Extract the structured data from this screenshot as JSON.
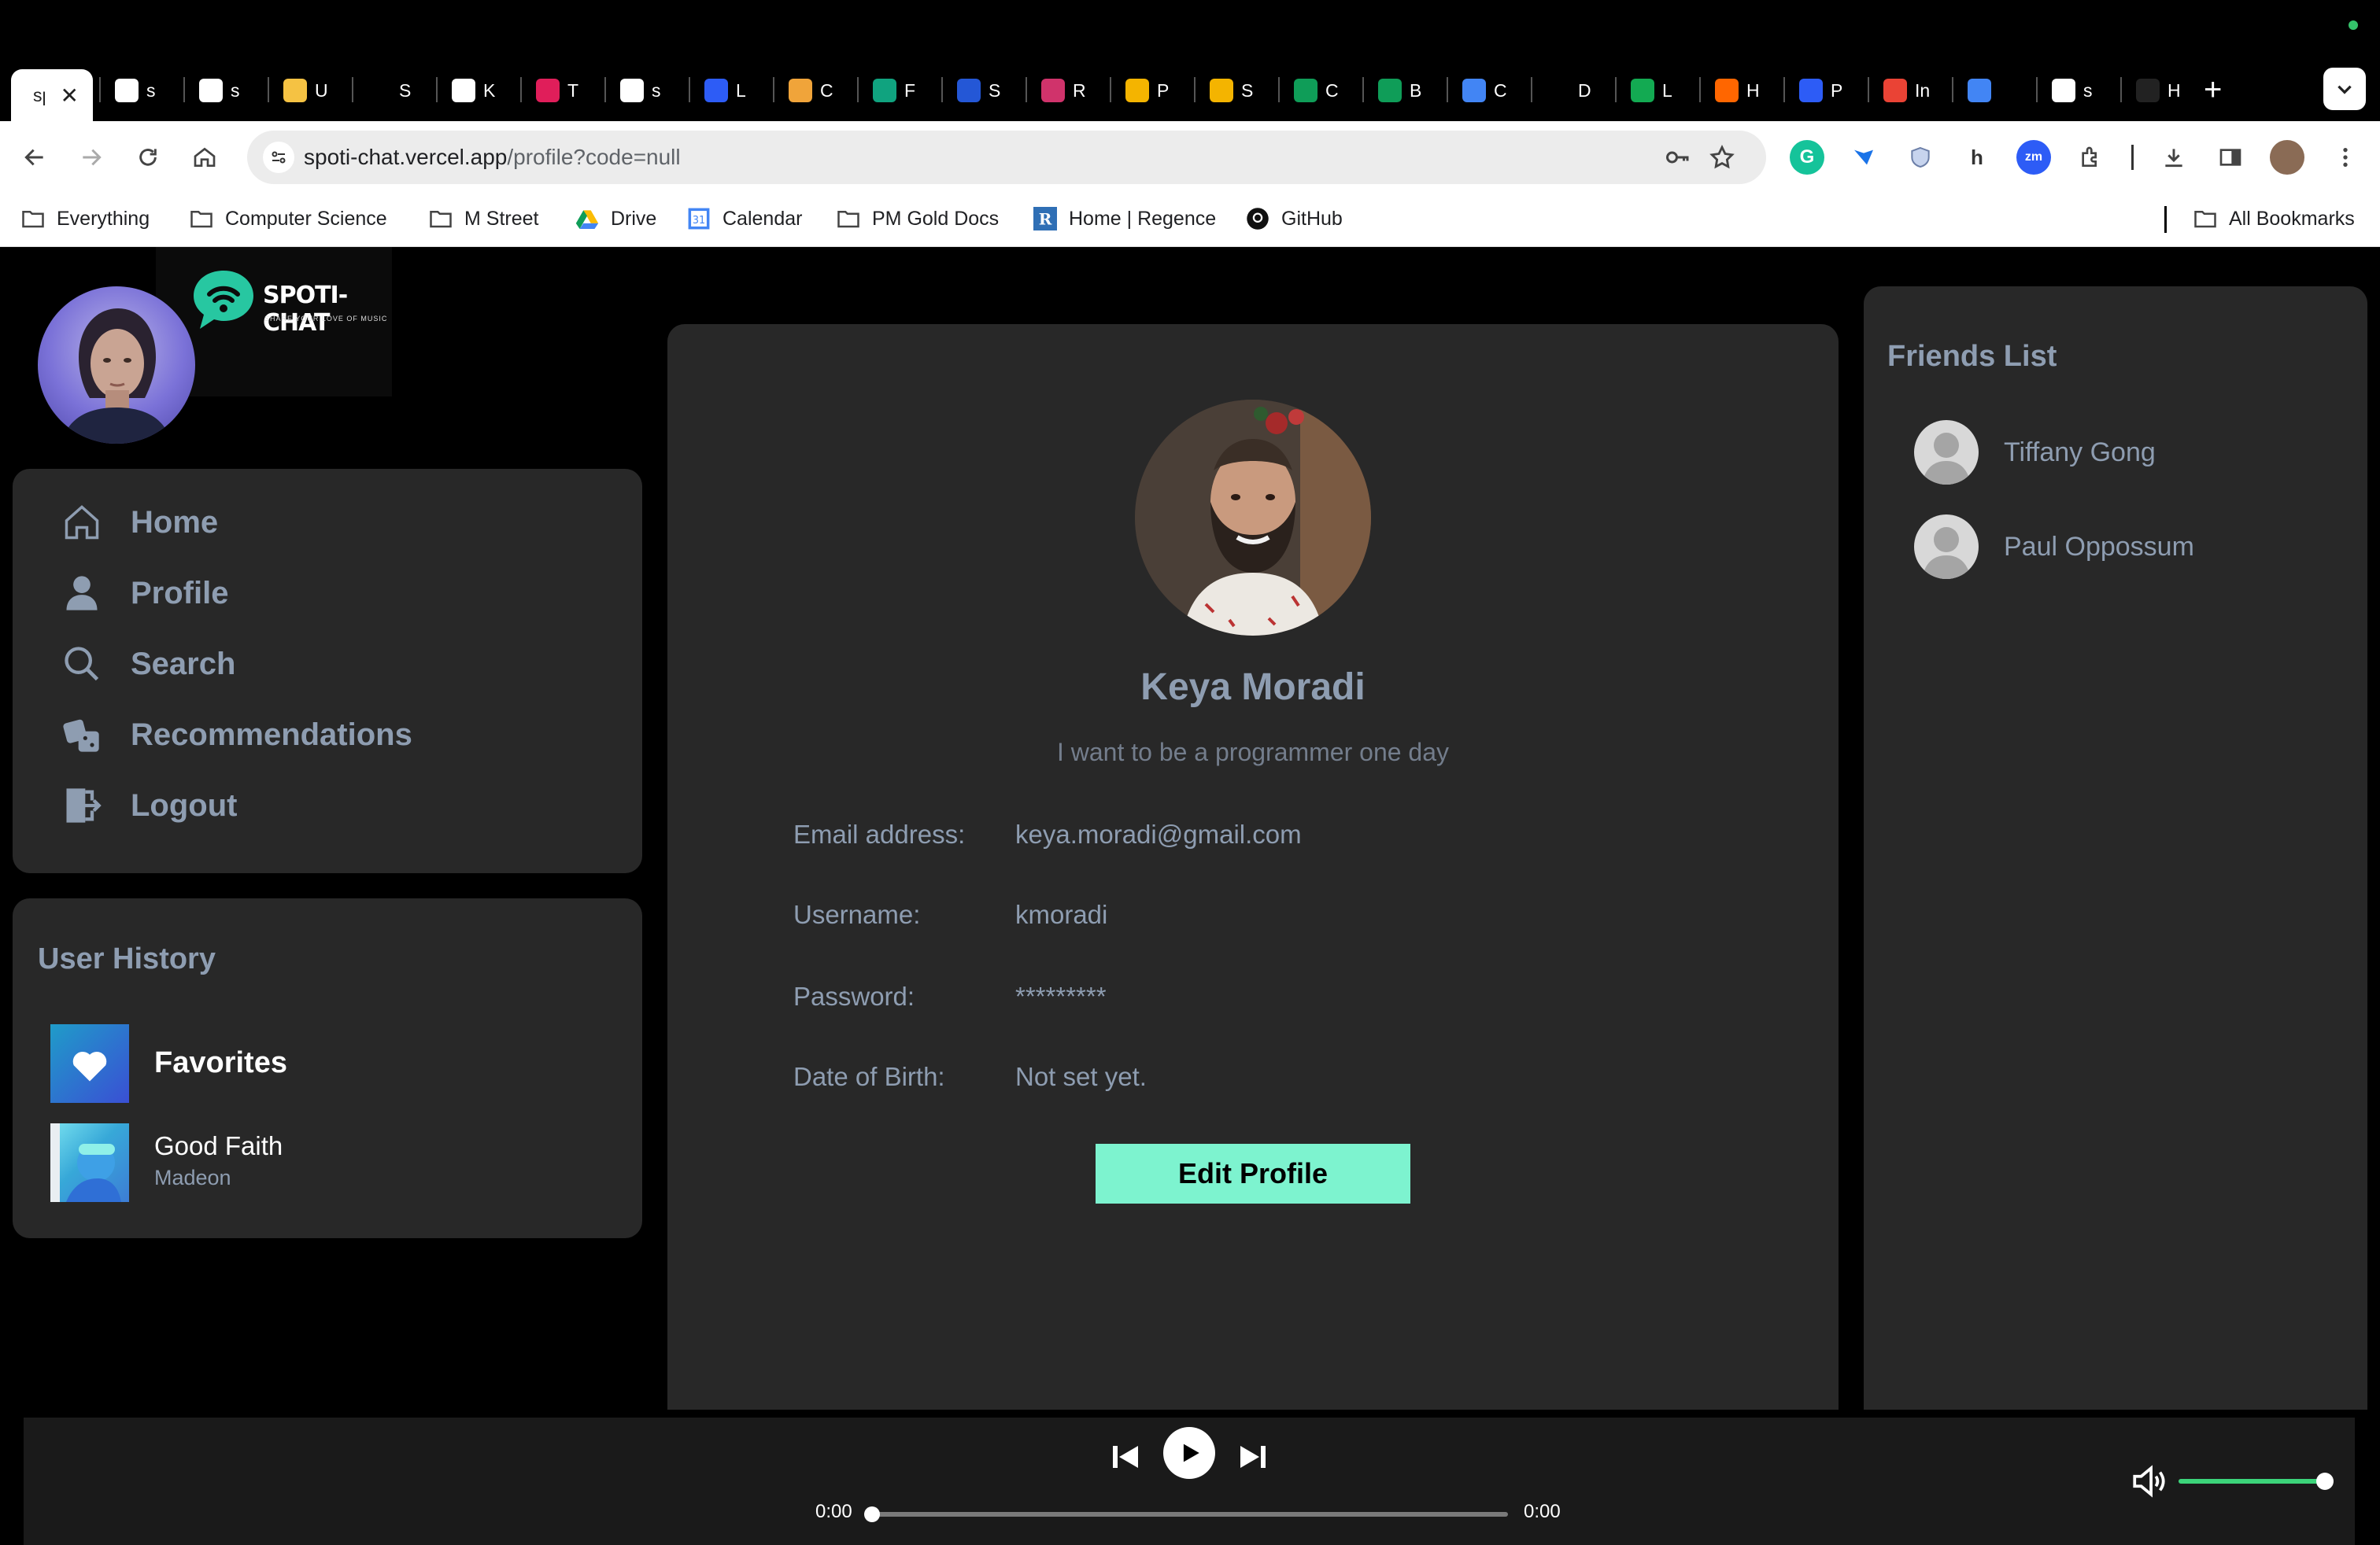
{
  "browser": {
    "tabs": [
      {
        "label": "sp",
        "fav_color": "#ffffff",
        "active": true
      },
      {
        "label": "s",
        "fav_color": "#ffffff"
      },
      {
        "label": "s",
        "fav_color": "#ffffff"
      },
      {
        "label": "U",
        "fav_color": "#f5c243"
      },
      {
        "label": "S",
        "fav_color": "#000000"
      },
      {
        "label": "K",
        "fav_color": "#ffffff"
      },
      {
        "label": "T",
        "fav_color": "#e01e5a"
      },
      {
        "label": "s",
        "fav_color": "#ffffff"
      },
      {
        "label": "L",
        "fav_color": "#2d5cf6"
      },
      {
        "label": "C",
        "fav_color": "#f0a43a"
      },
      {
        "label": "F",
        "fav_color": "#10a37f"
      },
      {
        "label": "S",
        "fav_color": "#2457d6"
      },
      {
        "label": "R",
        "fav_color": "#d0336b"
      },
      {
        "label": "P",
        "fav_color": "#f4b400"
      },
      {
        "label": "S",
        "fav_color": "#f4b400"
      },
      {
        "label": "C",
        "fav_color": "#0f9d58"
      },
      {
        "label": "B",
        "fav_color": "#0f9d58"
      },
      {
        "label": "C",
        "fav_color": "#4285f4"
      },
      {
        "label": "D",
        "fav_color": "#000000"
      },
      {
        "label": "L",
        "fav_color": "#13aa52"
      },
      {
        "label": "H",
        "fav_color": "#ff6600"
      },
      {
        "label": "P",
        "fav_color": "#2d5cf6"
      },
      {
        "label": "In",
        "fav_color": "#ea4335"
      },
      {
        "label": "",
        "fav_color": "#4285f4"
      },
      {
        "label": "s",
        "fav_color": "#ffffff"
      },
      {
        "label": "H",
        "fav_color": "#222222"
      }
    ],
    "url_host": "spoti-chat.vercel.app",
    "url_path": "/profile?code=null",
    "bookmarks": [
      {
        "label": "Everything",
        "icon": "folder-icon"
      },
      {
        "label": "Computer Science",
        "icon": "folder-icon"
      },
      {
        "label": "M Street",
        "icon": "folder-icon"
      },
      {
        "label": "Drive",
        "icon": "drive-icon"
      },
      {
        "label": "Calendar",
        "icon": "calendar-icon"
      },
      {
        "label": "PM Gold Docs",
        "icon": "folder-icon"
      },
      {
        "label": "Home | Regence",
        "icon": "regence-icon"
      },
      {
        "label": "GitHub",
        "icon": "github-icon"
      }
    ],
    "all_bookmarks": "All Bookmarks"
  },
  "app": {
    "logo": {
      "name": "SPOTI-CHAT",
      "tagline": "SHARE YOUR LOVE OF MUSIC"
    },
    "nav": [
      {
        "label": "Home",
        "icon": "home-icon"
      },
      {
        "label": "Profile",
        "icon": "person-icon"
      },
      {
        "label": "Search",
        "icon": "search-icon"
      },
      {
        "label": "Recommendations",
        "icon": "dice-icon"
      },
      {
        "label": "Logout",
        "icon": "logout-icon"
      }
    ],
    "history": {
      "title": "User History",
      "favorites_label": "Favorites",
      "track": {
        "title": "Good Faith",
        "artist": "Madeon"
      }
    },
    "profile": {
      "name": "Keya Moradi",
      "bio": "I want to be a programmer one day",
      "fields": [
        {
          "label": "Email address:",
          "value": "keya.moradi@gmail.com"
        },
        {
          "label": "Username:",
          "value": "kmoradi"
        },
        {
          "label": "Password:",
          "value": "*********"
        },
        {
          "label": "Date of Birth:",
          "value": "Not set yet."
        }
      ],
      "edit_button": "Edit Profile"
    },
    "friends": {
      "title": "Friends List",
      "items": [
        "Tiffany Gong",
        "Paul Oppossum"
      ]
    },
    "player": {
      "elapsed": "0:00",
      "duration": "0:00",
      "progress": 0,
      "volume": 1.0
    }
  },
  "colors": {
    "accent": "#7df3cf",
    "panel": "#282828",
    "muted_text": "#8e9db1",
    "volume": "#3cd47a"
  }
}
